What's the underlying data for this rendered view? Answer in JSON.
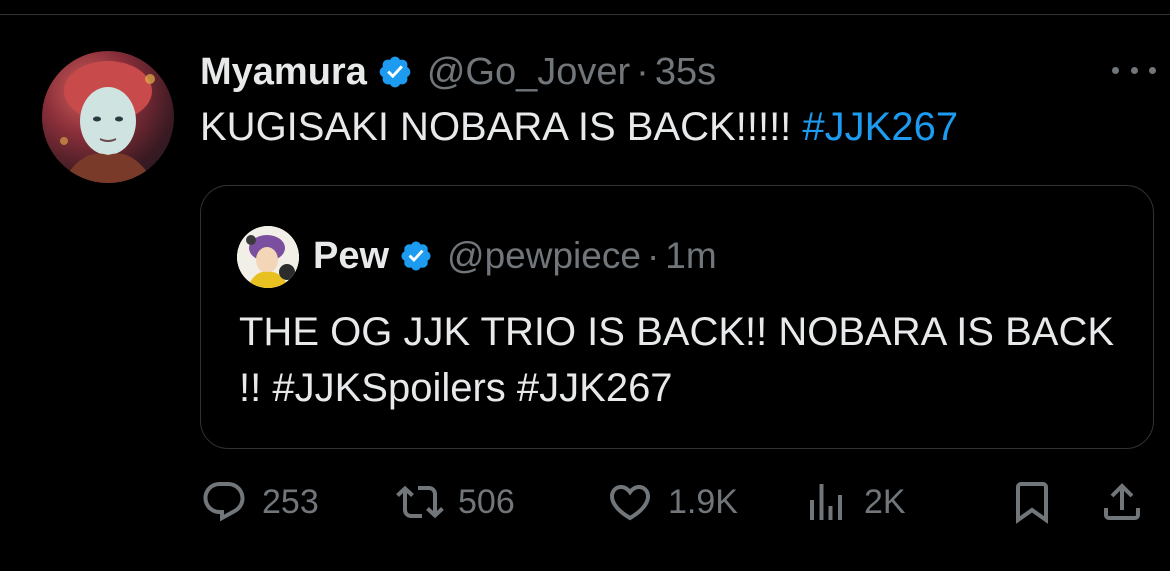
{
  "tweet": {
    "display_name": "Myamura",
    "handle": "@Go_Jover",
    "separator": "·",
    "time": "35s",
    "text": "KUGISAKI NOBARA IS BACK!!!!!",
    "hashtag": "#JJK267",
    "verified": true
  },
  "quote": {
    "display_name": "Pew",
    "handle": "@pewpiece",
    "separator": "·",
    "time": "1m",
    "text": "THE OG JJK TRIO IS BACK!! NOBARA IS BACK !! #JJKSpoilers #JJK267",
    "verified": true
  },
  "actions": {
    "replies": "253",
    "reposts": "506",
    "likes": "1.9K",
    "views": "2K"
  },
  "colors": {
    "background": "#000000",
    "text": "#e7e9ea",
    "muted": "#71767b",
    "accent": "#1d9bf0",
    "border": "#2f3336"
  },
  "icons": [
    "avatar",
    "verified-badge-icon",
    "more-icon",
    "reply-icon",
    "retweet-icon",
    "like-icon",
    "views-icon",
    "bookmark-icon",
    "share-icon"
  ]
}
